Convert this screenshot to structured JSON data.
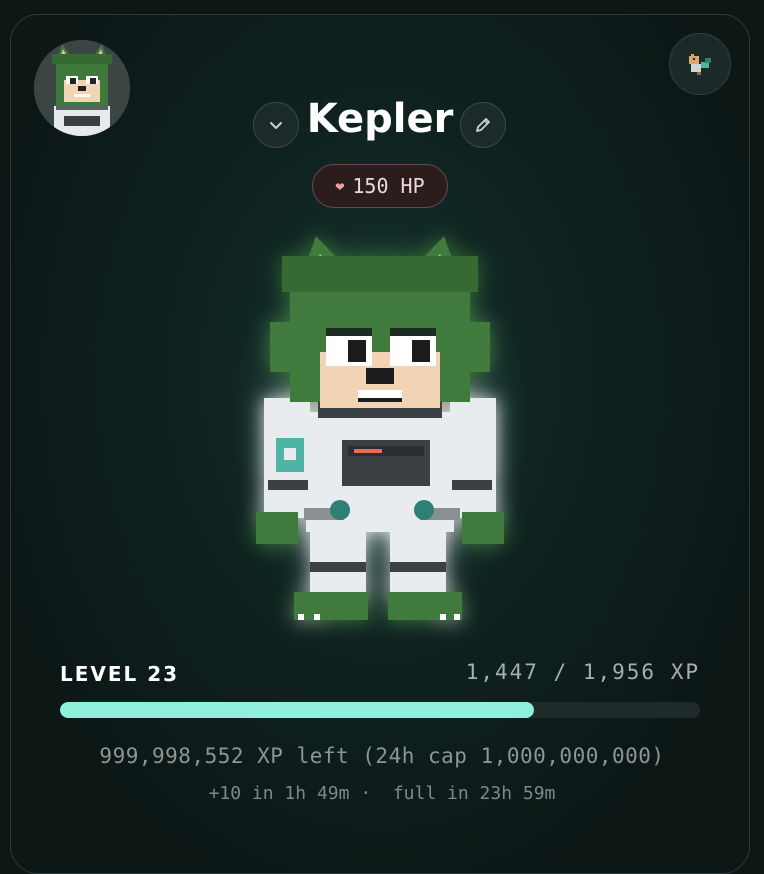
{
  "pet": {
    "name": "Kepler",
    "hp_label": "150 HP",
    "hp_icon": "heart-icon"
  },
  "header": {
    "avatar_icon": "fox-avatar-icon",
    "switch_icon": "pixel-companion-icon",
    "dropdown_icon": "chevron-down-icon",
    "edit_icon": "pencil-icon"
  },
  "level": {
    "label": "LEVEL 23",
    "xp_text": "1,447 / 1,956 XP",
    "progress_fraction": 0.74
  },
  "stats": {
    "remaining_text": "999,998,552 XP left (24h cap 1,000,000,000)",
    "regen_text": "+10 in 1h 49m",
    "separator": "·",
    "full_text": "full in 23h 59m"
  },
  "colors": {
    "accent": "#8ff0dc",
    "fur": "#3f7a3c",
    "suit": "#e8ecef",
    "hp_border": "#6a4a49"
  }
}
